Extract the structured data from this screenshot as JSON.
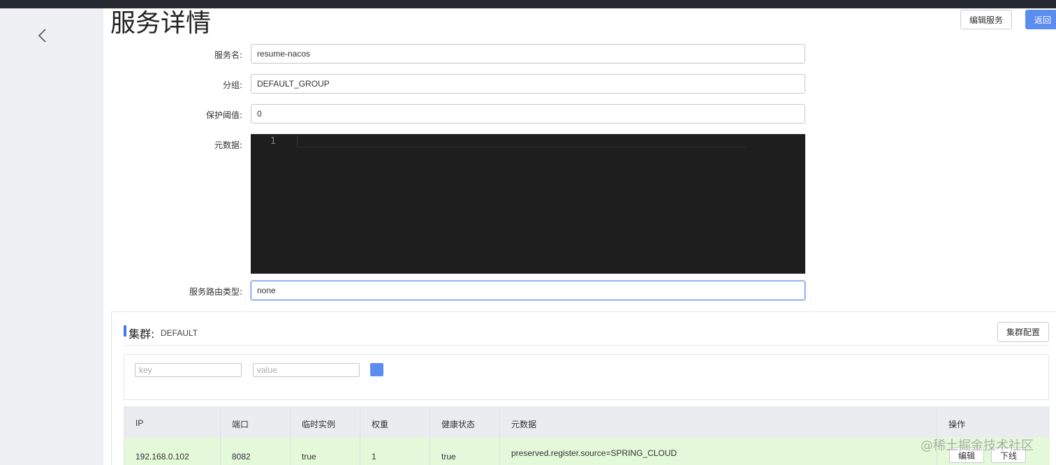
{
  "page": {
    "title": "服务详情"
  },
  "header": {
    "edit_service_label": "编辑服务",
    "back_label": "返回"
  },
  "form": {
    "service_name": {
      "label": "服务名:",
      "value": "resume-nacos"
    },
    "group": {
      "label": "分组:",
      "value": "DEFAULT_GROUP"
    },
    "protect_threshold": {
      "label": "保护阈值:",
      "value": "0"
    },
    "metadata": {
      "label": "元数据:",
      "line_number": "1"
    },
    "selector_type": {
      "label": "服务路由类型:",
      "value": "none"
    }
  },
  "cluster": {
    "title": "集群:",
    "name": "DEFAULT",
    "config_label": "集群配置",
    "filter": {
      "key_placeholder": "key",
      "value_placeholder": "value"
    },
    "table": {
      "headers": [
        "IP",
        "端口",
        "临时实例",
        "权重",
        "健康状态",
        "元数据",
        "操作"
      ],
      "rows": [
        {
          "ip": "192.168.0.102",
          "port": "8082",
          "ephemeral": "true",
          "weight": "1",
          "healthy": "true",
          "metadata": "preserved.register.source=SPRING_CLOUD",
          "actions": [
            "编辑",
            "下线"
          ]
        }
      ]
    }
  },
  "watermark": "@稀土掘金技术社区",
  "colors": {
    "primary": "#5b8def",
    "healthy_row": "#e3f9d9",
    "editor_bg": "#1e1e1e",
    "topbar": "#262a30"
  }
}
